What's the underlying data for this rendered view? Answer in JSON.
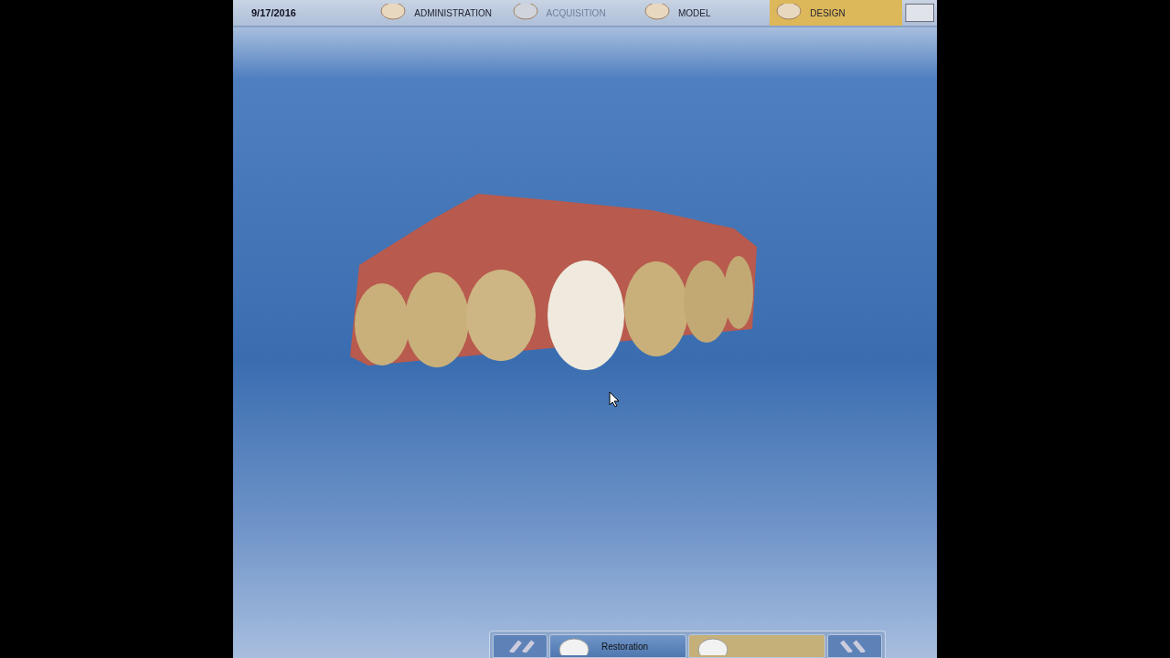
{
  "header": {
    "date": "9/17/2016"
  },
  "phases": [
    {
      "label": "ADMINISTRATION",
      "selected": false,
      "disabled": false
    },
    {
      "label": "ACQUISITION",
      "selected": false,
      "disabled": true
    },
    {
      "label": "MODEL",
      "selected": false,
      "disabled": false
    },
    {
      "label": "DESIGN",
      "selected": true,
      "disabled": false
    }
  ],
  "steps": [
    {
      "label": "Restoration",
      "selected": false
    },
    {
      "selected": true
    }
  ]
}
